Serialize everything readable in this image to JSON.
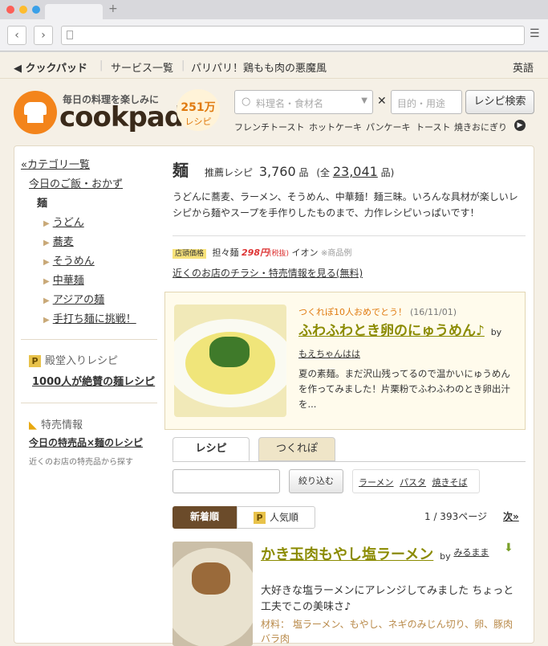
{
  "breadcrumb": {
    "home": "クックパッド",
    "services": "サービス一覧",
    "recipe": "パリパリ！鶏もも肉の悪魔風",
    "lang": "英語"
  },
  "header": {
    "tagline": "毎日の料理を楽しみに",
    "logo": "cookpad",
    "badge_num": "251万",
    "badge_unit": "レシピ",
    "search_ph": "料理名・食材名",
    "purpose_ph": "目的・用途",
    "search_btn": "レシピ検索",
    "times": "✕",
    "keywords": [
      "フレンチトースト",
      "ホットケーキ",
      "パンケーキ",
      "トースト",
      "焼きおにぎり"
    ]
  },
  "sidebar": {
    "back": "«カテゴリ一覧",
    "parent": "今日のご飯・おかず",
    "current": "麺",
    "items": [
      "うどん",
      "蕎麦",
      "そうめん",
      "中華麺",
      "アジアの麺",
      "手打ち麺に挑戦！"
    ],
    "hall_title": "殿堂入りレシピ",
    "hall_link": "1000人が絶賛の麺レシピ",
    "sale_title": "特売情報",
    "sale_link": "今日の特売品×麺のレシピ",
    "sale_note": "近くのお店の特売品から探す"
  },
  "main": {
    "title": "麺",
    "rec_label": "推薦レシピ",
    "rec_count": "3,760",
    "unit": "品",
    "all_prefix": "(全",
    "all_count": "23,041",
    "all_suffix": "品)",
    "desc": "うどんに蕎麦、ラーメン、そうめん、中華麺！麺三昧。いろんな具材が楽しいレシピから麺やスープを手作りしたものまで、力作レシピいっぱいです！",
    "price_tag": "店頭価格",
    "price_item": "担々麺",
    "price": "298円",
    "price_tax": "(税抜)",
    "price_store": "イオン",
    "price_note": "※商品例",
    "flyer_link": "近くのお店のチラシ・特売情報を見る(無料)"
  },
  "featured": {
    "note": "つくれぽ10人おめでとう！",
    "date": "(16/11/01)",
    "title": "ふわふわとき卵のにゅうめん♪",
    "by": "by",
    "author": "もえちゃんはは",
    "desc": "夏の素麺。まだ沢山残ってるので温かいにゅうめんを作ってみました！片栗粉でふわふわのとき卵出汁を..."
  },
  "tabs": {
    "recipe": "レシピ",
    "report": "つくれぽ"
  },
  "filter": {
    "btn": "絞り込む",
    "tags": [
      "ラーメン",
      "パスタ",
      "焼きそば"
    ]
  },
  "sort": {
    "new": "新着順",
    "popular": "人気順",
    "pages": "1 / 393ページ",
    "next": "次»"
  },
  "recipe": {
    "title": "かき玉肉もやし塩ラーメン",
    "by": "by",
    "author": "みるまま",
    "desc": "大好きな塩ラーメンにアレンジしてみました ちょっと工夫でこの美味さ♪",
    "mat_label": "材料：",
    "materials": "塩ラーメン、もやし、ネギのみじん切り、卵、豚肉バラ肉"
  }
}
